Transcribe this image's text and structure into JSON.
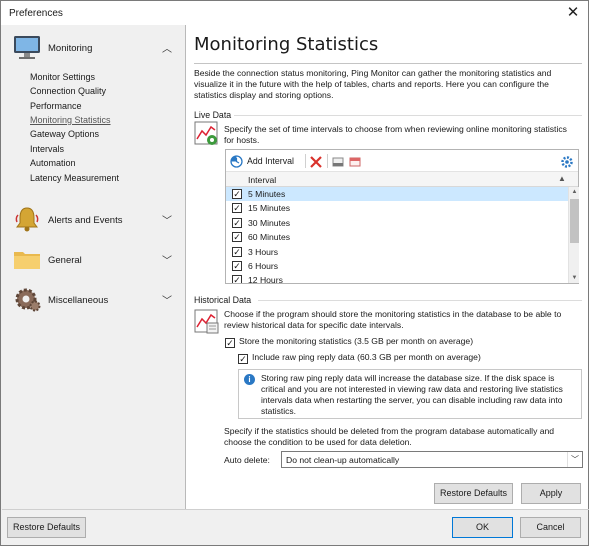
{
  "window": {
    "title": "Preferences",
    "close_glyph": "✕"
  },
  "sidebar": {
    "categories": [
      {
        "label": "Monitoring",
        "icon": "monitor-icon",
        "expanded": true
      },
      {
        "label": "Alerts and Events",
        "icon": "bell-icon",
        "expanded": false
      },
      {
        "label": "General",
        "icon": "folder-icon",
        "expanded": false
      },
      {
        "label": "Miscellaneous",
        "icon": "gear-icon",
        "expanded": false
      }
    ],
    "monitoring_items": [
      "Monitor Settings",
      "Connection Quality",
      "Performance",
      "Monitoring Statistics",
      "Gateway Options",
      "Intervals",
      "Automation",
      "Latency Measurement"
    ],
    "active_item": "Monitoring Statistics"
  },
  "page": {
    "title": "Monitoring Statistics",
    "intro": "Beside the connection status monitoring, Ping Monitor can gather the monitoring statistics and visualize it in the future with the help of tables, charts and reports. Here you can configure the statistics display and storing options."
  },
  "live_data": {
    "heading": "Live Data",
    "description": "Specify the set of time intervals to choose from when reviewing online monitoring statistics for hosts.",
    "toolbar": {
      "add_label": "Add Interval"
    },
    "column_header": "Interval",
    "rows": [
      {
        "label": "5 Minutes",
        "checked": true
      },
      {
        "label": "15 Minutes",
        "checked": true
      },
      {
        "label": "30 Minutes",
        "checked": true
      },
      {
        "label": "60 Minutes",
        "checked": true
      },
      {
        "label": "3 Hours",
        "checked": true
      },
      {
        "label": "6 Hours",
        "checked": true
      },
      {
        "label": "12 Hours",
        "checked": true
      }
    ],
    "selected_row": 0
  },
  "historical_data": {
    "heading": "Historical Data",
    "description": "Choose if the program should store the monitoring statistics in the database to be able to review historical data for specific date intervals.",
    "store_label": "Store the monitoring statistics (3.5 GB per month on average)",
    "store_checked": true,
    "raw_label": "Include raw ping reply data (60.3 GB per month on average)",
    "raw_checked": true,
    "info": "Storing raw ping reply data will increase the database size. If the disk space is critical and you are not interested in viewing raw data and restoring live statistics intervals data when restarting the server, you can disable including raw data into statistics.",
    "delete_description": "Specify if the statistics should be deleted from the program database automatically and choose the condition to be used for data deletion.",
    "auto_delete_label": "Auto delete:",
    "auto_delete_value": "Do not clean-up automatically"
  },
  "buttons": {
    "restore_defaults_page": "Restore Defaults",
    "apply": "Apply",
    "restore_defaults_global": "Restore Defaults",
    "ok": "OK",
    "cancel": "Cancel"
  },
  "colors": {
    "selection": "#cce8ff",
    "accent": "#0078d7"
  }
}
